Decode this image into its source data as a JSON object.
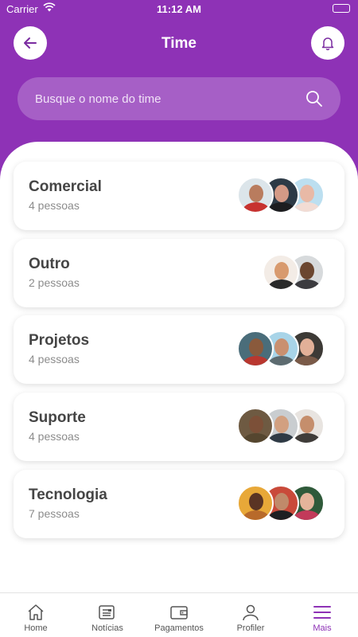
{
  "status_bar": {
    "carrier": "Carrier",
    "time": "11:12 AM"
  },
  "header": {
    "title": "Time"
  },
  "search": {
    "placeholder": "Busque o nome do time"
  },
  "teams": [
    {
      "name": "Comercial",
      "count": "4 pessoas"
    },
    {
      "name": "Outro",
      "count": "2 pessoas"
    },
    {
      "name": "Projetos",
      "count": "4 pessoas"
    },
    {
      "name": "Suporte",
      "count": "4 pessoas"
    },
    {
      "name": "Tecnologia",
      "count": "7 pessoas"
    }
  ],
  "nav": {
    "items": [
      {
        "label": "Home",
        "icon": "home-icon"
      },
      {
        "label": "Notícias",
        "icon": "news-icon"
      },
      {
        "label": "Pagamentos",
        "icon": "wallet-icon"
      },
      {
        "label": "Profiler",
        "icon": "user-icon"
      },
      {
        "label": "Mais",
        "icon": "menu-icon"
      }
    ],
    "active": "Mais"
  },
  "colors": {
    "brand": "#8e32b6",
    "card_title": "#454545",
    "muted": "#8c8c8c"
  }
}
